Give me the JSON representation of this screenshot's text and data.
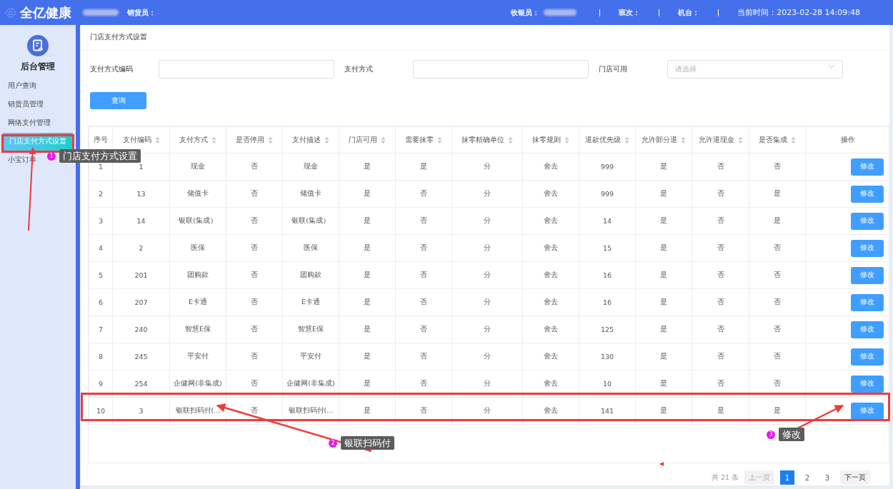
{
  "header": {
    "brand": "全亿健康",
    "seller_label": "销货员：",
    "cashier_label": "收银员：",
    "shift_label": "班次：",
    "terminal_label": "机台：",
    "time": "当前时间：2023-02-28 14:09:48"
  },
  "sidebar": {
    "title": "后台管理",
    "items": [
      {
        "label": "用户查询",
        "selected": false
      },
      {
        "label": "销货员管理",
        "selected": false
      },
      {
        "label": "网络支付管理",
        "selected": false
      },
      {
        "label": "门店支付方式设置",
        "selected": true
      },
      {
        "label": "小宝订单",
        "selected": false
      }
    ]
  },
  "breadcrumb": "门店支付方式设置",
  "filters": [
    {
      "kind": "input",
      "label": "支付方式编码"
    },
    {
      "kind": "input",
      "label": "支付方式"
    },
    {
      "kind": "select",
      "label": "门店可用",
      "placeholder": "请选择"
    }
  ],
  "query_button": "查询",
  "table": {
    "columns": [
      {
        "label": "序号",
        "sortable": false
      },
      {
        "label": "支付编码",
        "sortable": true
      },
      {
        "label": "支付方式",
        "sortable": true
      },
      {
        "label": "是否停用",
        "sortable": true
      },
      {
        "label": "支付描述",
        "sortable": true
      },
      {
        "label": "门店可用",
        "sortable": true
      },
      {
        "label": "需要抹零",
        "sortable": true
      },
      {
        "label": "抹零精确单位",
        "sortable": true
      },
      {
        "label": "抹零规则",
        "sortable": true
      },
      {
        "label": "退款优先级",
        "sortable": true
      },
      {
        "label": "允许部分退",
        "sortable": true
      },
      {
        "label": "允许退现金",
        "sortable": true
      },
      {
        "label": "是否集成",
        "sortable": true
      },
      {
        "label": "操作",
        "sortable": false
      }
    ],
    "rows": [
      {
        "cells": [
          "1",
          "1",
          "现金",
          "否",
          "现金",
          "是",
          "是",
          "分",
          "舍去",
          "999",
          "是",
          "否",
          "否"
        ],
        "action": "修改"
      },
      {
        "cells": [
          "2",
          "13",
          "储值卡",
          "否",
          "储值卡",
          "是",
          "否",
          "分",
          "舍去",
          "999",
          "是",
          "否",
          "是"
        ],
        "action": "修改"
      },
      {
        "cells": [
          "3",
          "14",
          "银联(集成）",
          "否",
          "银联(集成）",
          "是",
          "否",
          "分",
          "舍去",
          "14",
          "是",
          "否",
          "是"
        ],
        "action": "修改"
      },
      {
        "cells": [
          "4",
          "2",
          "医保",
          "否",
          "医保",
          "是",
          "否",
          "分",
          "舍去",
          "15",
          "是",
          "否",
          "否"
        ],
        "action": "修改"
      },
      {
        "cells": [
          "5",
          "201",
          "团购款",
          "否",
          "团购款",
          "是",
          "否",
          "分",
          "舍去",
          "16",
          "是",
          "否",
          "否"
        ],
        "action": "修改"
      },
      {
        "cells": [
          "6",
          "207",
          "E卡通",
          "否",
          "E卡通",
          "是",
          "否",
          "分",
          "舍去",
          "16",
          "是",
          "否",
          "否"
        ],
        "action": "修改"
      },
      {
        "cells": [
          "7",
          "240",
          "智慧E保",
          "否",
          "智慧E保",
          "是",
          "否",
          "分",
          "舍去",
          "125",
          "是",
          "否",
          "否"
        ],
        "action": "修改"
      },
      {
        "cells": [
          "8",
          "245",
          "平安付",
          "否",
          "平安付",
          "是",
          "否",
          "分",
          "舍去",
          "130",
          "是",
          "否",
          "否"
        ],
        "action": "修改"
      },
      {
        "cells": [
          "9",
          "254",
          "企健网(非集成)",
          "否",
          "企健网(非集成)",
          "是",
          "否",
          "分",
          "舍去",
          "10",
          "是",
          "否",
          "否"
        ],
        "action": "修改"
      },
      {
        "cells": [
          "10",
          "3",
          "银联扫码付(...",
          "否",
          "银联扫码付(...",
          "是",
          "否",
          "分",
          "舍去",
          "141",
          "是",
          "是",
          "是"
        ],
        "action": "修改"
      }
    ]
  },
  "pagination": {
    "total": "共 21 条",
    "prev": "上一页",
    "pages": [
      {
        "label": "1",
        "selected": true
      },
      {
        "label": "2",
        "selected": false
      },
      {
        "label": "3",
        "selected": false
      }
    ],
    "next": "下一页"
  },
  "annotations": [
    {
      "number": "1",
      "label": "门店支付方式设置"
    },
    {
      "number": "2",
      "label": "银联扫码付"
    },
    {
      "number": "3",
      "label": "修改"
    }
  ]
}
